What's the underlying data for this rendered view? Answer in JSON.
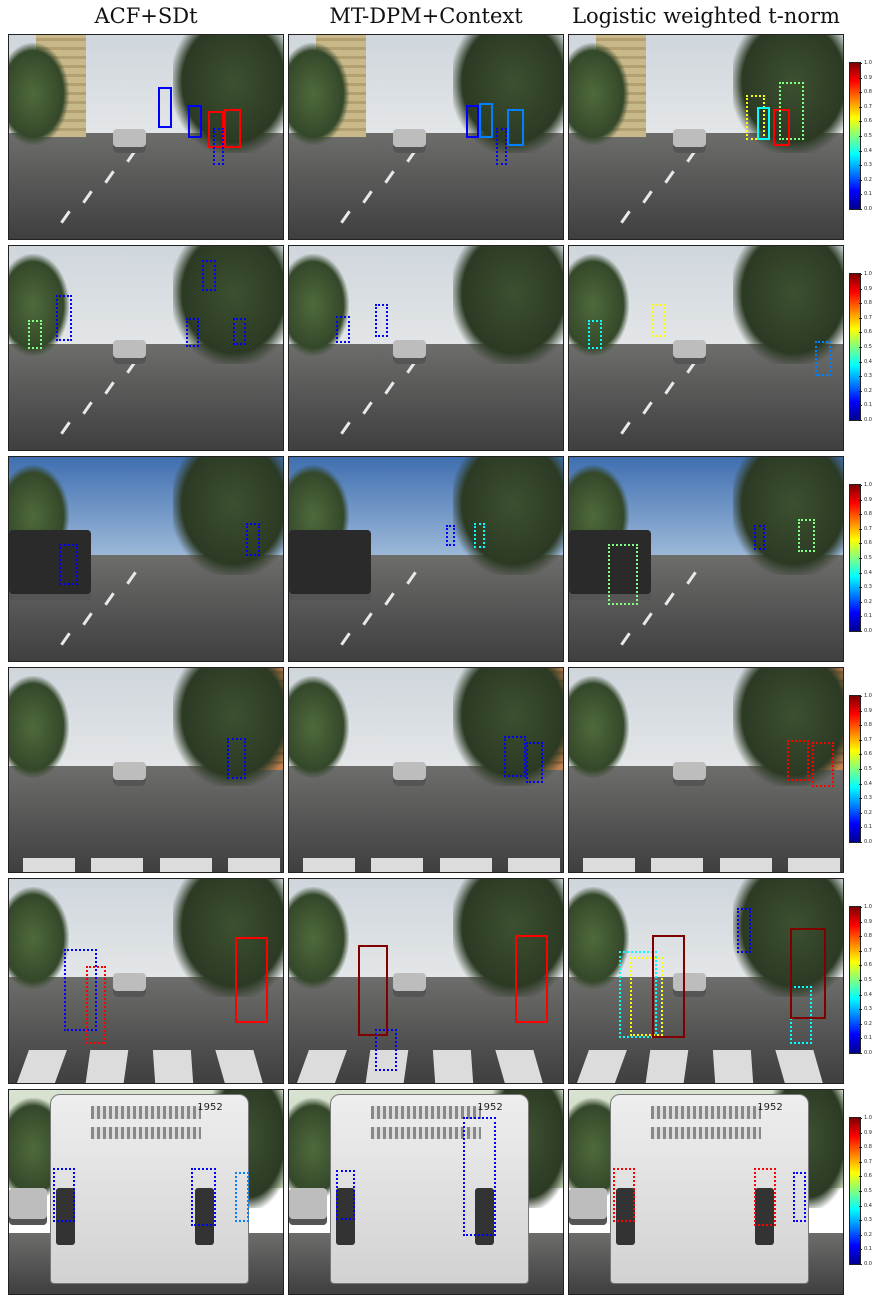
{
  "columns": [
    {
      "label": "ACF+SDt"
    },
    {
      "label": "MT-DPM+Context"
    },
    {
      "label": "Logistic weighted t-norm"
    }
  ],
  "colorbar": {
    "ticks": [
      "1.0",
      "0.9",
      "0.8",
      "0.7",
      "0.6",
      "0.5",
      "0.4",
      "0.3",
      "0.2",
      "0.1",
      "0.0"
    ],
    "colors": [
      "#00008f",
      "#0000ff",
      "#0080ff",
      "#00ffff",
      "#80ff80",
      "#ffff00",
      "#ff8000",
      "#ff0000",
      "#800000"
    ]
  },
  "rows": [
    {
      "scene": "city",
      "columns": [
        {
          "boxes": [
            {
              "color": "#0000ff",
              "style": "solid",
              "score": 0.05
            },
            {
              "color": "#0000ff",
              "style": "solid",
              "score": 0.08
            },
            {
              "color": "#ff0000",
              "style": "solid",
              "score": 0.9
            },
            {
              "color": "#ff0000",
              "style": "solid",
              "score": 0.88
            },
            {
              "color": "#0000ff",
              "style": "dotted",
              "score": 0.02
            }
          ]
        },
        {
          "boxes": [
            {
              "color": "#0000ff",
              "style": "solid",
              "score": 0.05
            },
            {
              "color": "#0080ff",
              "style": "solid",
              "score": 0.25
            },
            {
              "color": "#0080ff",
              "style": "solid",
              "score": 0.28
            },
            {
              "color": "#0000ff",
              "style": "dotted",
              "score": 0.03
            }
          ]
        },
        {
          "boxes": [
            {
              "color": "#ffff00",
              "style": "dotted",
              "score": 0.62
            },
            {
              "color": "#00ffff",
              "style": "solid",
              "score": 0.42
            },
            {
              "color": "#ff0000",
              "style": "solid",
              "score": 0.88
            },
            {
              "color": "#80ff80",
              "style": "dotted",
              "score": 0.5
            }
          ]
        }
      ]
    },
    {
      "scene": "palms",
      "columns": [
        {
          "boxes": [
            {
              "color": "#0000ff",
              "style": "dotted",
              "score": 0.05
            },
            {
              "color": "#80ff80",
              "style": "dotted",
              "score": 0.5
            },
            {
              "color": "#0000ff",
              "style": "dotted",
              "score": 0.05
            },
            {
              "color": "#0000ff",
              "style": "dotted",
              "score": 0.04
            },
            {
              "color": "#0000ff",
              "style": "dotted",
              "score": 0.04
            }
          ]
        },
        {
          "boxes": [
            {
              "color": "#0000ff",
              "style": "dotted",
              "score": 0.05
            },
            {
              "color": "#0000ff",
              "style": "dotted",
              "score": 0.05
            }
          ]
        },
        {
          "boxes": [
            {
              "color": "#00ffff",
              "style": "dotted",
              "score": 0.4
            },
            {
              "color": "#ffff00",
              "style": "dotted",
              "score": 0.62
            },
            {
              "color": "#0080ff",
              "style": "dotted",
              "score": 0.3
            }
          ]
        }
      ]
    },
    {
      "scene": "suv",
      "columns": [
        {
          "boxes": [
            {
              "color": "#0000ff",
              "style": "dotted",
              "score": 0.05
            },
            {
              "color": "#0000ff",
              "style": "dotted",
              "score": 0.05
            }
          ]
        },
        {
          "boxes": [
            {
              "color": "#0000ff",
              "style": "dotted",
              "score": 0.05
            },
            {
              "color": "#00ffff",
              "style": "dotted",
              "score": 0.4
            }
          ]
        },
        {
          "boxes": [
            {
              "color": "#80ff80",
              "style": "dotted",
              "score": 0.5
            },
            {
              "color": "#0000ff",
              "style": "dotted",
              "score": 0.05
            },
            {
              "color": "#80ff80",
              "style": "dotted",
              "score": 0.5
            }
          ]
        }
      ]
    },
    {
      "scene": "street",
      "columns": [
        {
          "boxes": [
            {
              "color": "#0000ff",
              "style": "dotted",
              "score": 0.05
            }
          ]
        },
        {
          "boxes": [
            {
              "color": "#0000ff",
              "style": "dotted",
              "score": 0.05
            },
            {
              "color": "#0000ff",
              "style": "dotted",
              "score": 0.05
            }
          ]
        },
        {
          "boxes": [
            {
              "color": "#ff0000",
              "style": "dotted",
              "score": 0.88
            },
            {
              "color": "#ff0000",
              "style": "dotted",
              "score": 0.88
            }
          ]
        }
      ]
    },
    {
      "scene": "crosswalk",
      "columns": [
        {
          "boxes": [
            {
              "color": "#0000ff",
              "style": "dotted",
              "score": 0.05
            },
            {
              "color": "#ff0000",
              "style": "dotted",
              "score": 0.88
            },
            {
              "color": "#ff0000",
              "style": "solid",
              "score": 0.9
            }
          ]
        },
        {
          "boxes": [
            {
              "color": "#800000",
              "style": "solid",
              "score": 0.98
            },
            {
              "color": "#0000ff",
              "style": "dotted",
              "score": 0.05
            },
            {
              "color": "#ff0000",
              "style": "solid",
              "score": 0.9
            }
          ]
        },
        {
          "boxes": [
            {
              "color": "#0000ff",
              "style": "dotted",
              "score": 0.05
            },
            {
              "color": "#00ffff",
              "style": "dotted",
              "score": 0.4
            },
            {
              "color": "#ffff00",
              "style": "dotted",
              "score": 0.62
            },
            {
              "color": "#800000",
              "style": "solid",
              "score": 0.98
            },
            {
              "color": "#00ffff",
              "style": "dotted",
              "score": 0.4
            },
            {
              "color": "#800000",
              "style": "solid",
              "score": 0.98
            }
          ]
        }
      ]
    },
    {
      "scene": "bus",
      "bus_number": "1952",
      "columns": [
        {
          "boxes": [
            {
              "color": "#0000ff",
              "style": "dotted",
              "score": 0.05
            },
            {
              "color": "#0000ff",
              "style": "dotted",
              "score": 0.05
            },
            {
              "color": "#0080ff",
              "style": "dotted",
              "score": 0.28
            }
          ]
        },
        {
          "boxes": [
            {
              "color": "#0000ff",
              "style": "dotted",
              "score": 0.05
            },
            {
              "color": "#0000ff",
              "style": "dotted",
              "score": 0.05
            }
          ]
        },
        {
          "boxes": [
            {
              "color": "#ff0000",
              "style": "dotted",
              "score": 0.88
            },
            {
              "color": "#ff0000",
              "style": "dotted",
              "score": 0.88
            },
            {
              "color": "#0000ff",
              "style": "dotted",
              "score": 0.05
            }
          ]
        }
      ]
    }
  ]
}
